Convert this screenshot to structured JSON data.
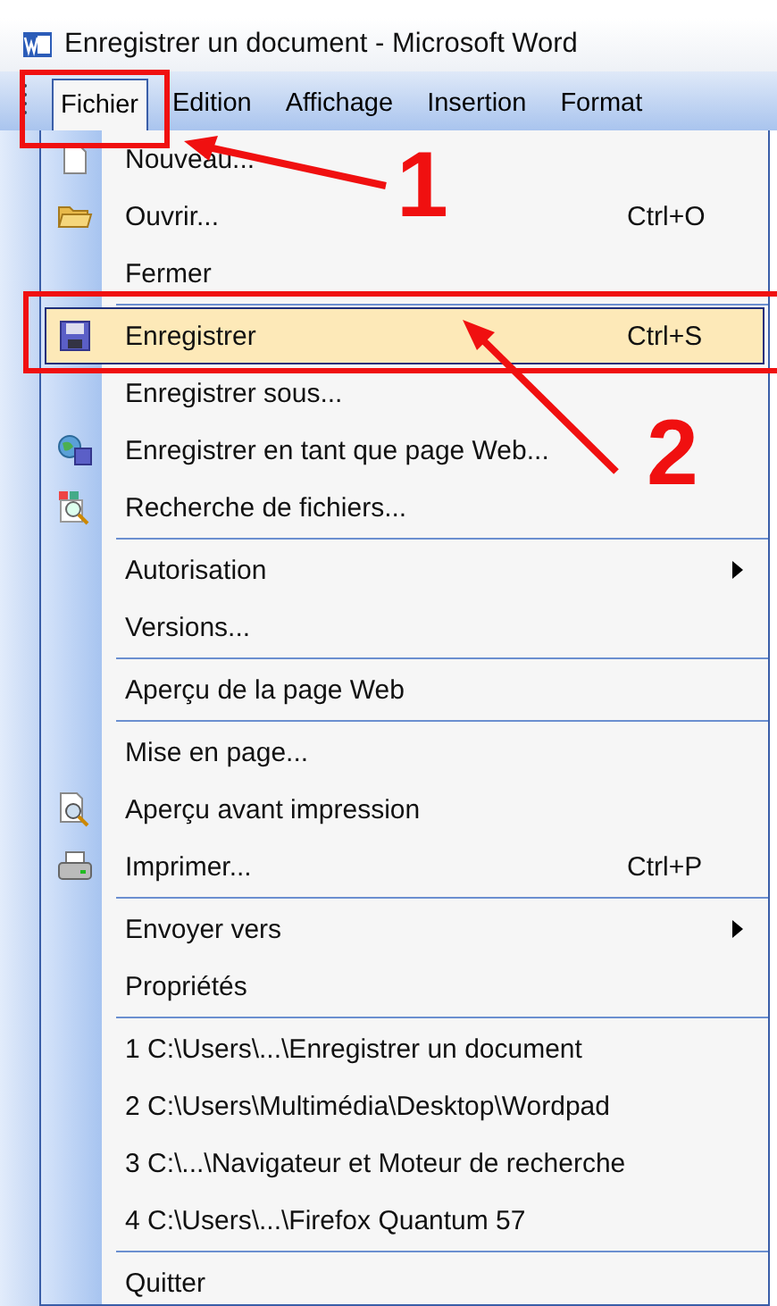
{
  "window": {
    "title": "Enregistrer un document - Microsoft Word"
  },
  "menu_bar": [
    {
      "label": "Fichier",
      "selected": true
    },
    {
      "label": "Edition",
      "selected": false
    },
    {
      "label": "Affichage",
      "selected": false
    },
    {
      "label": "Insertion",
      "selected": false
    },
    {
      "label": "Format",
      "selected": false
    }
  ],
  "menu": [
    {
      "label": "Nouveau...",
      "selected": false
    },
    {
      "label": "Ouvrir...",
      "shortcut": "Ctrl+O",
      "selected": false
    },
    {
      "label": "Fermer",
      "selected": false
    },
    {
      "kind": "separator"
    },
    {
      "label": "Enregistrer",
      "shortcut": "Ctrl+S",
      "selected": true
    },
    {
      "label": "Enregistrer sous...",
      "selected": false
    },
    {
      "label": "Enregistrer en tant que page Web...",
      "selected": false
    },
    {
      "label": "Recherche de fichiers...",
      "selected": false
    },
    {
      "kind": "separator"
    },
    {
      "label": "Autorisation",
      "submenu": true,
      "selected": false
    },
    {
      "label": "Versions...",
      "selected": false
    },
    {
      "kind": "separator"
    },
    {
      "label": "Aperçu de la page Web",
      "selected": false
    },
    {
      "kind": "separator"
    },
    {
      "label": "Mise en page...",
      "selected": false
    },
    {
      "label": "Aperçu avant impression",
      "selected": false
    },
    {
      "label": "Imprimer...",
      "shortcut": "Ctrl+P",
      "selected": false
    },
    {
      "kind": "separator"
    },
    {
      "label": "Envoyer vers",
      "submenu": true,
      "selected": false
    },
    {
      "label": "Propriétés",
      "selected": false
    },
    {
      "kind": "separator"
    },
    {
      "label": "1 C:\\Users\\...\\Enregistrer un document",
      "selected": false
    },
    {
      "label": "2 C:\\Users\\Multimédia\\Desktop\\Wordpad",
      "selected": false
    },
    {
      "label": "3 C:\\...\\Navigateur et Moteur de recherche",
      "selected": false
    },
    {
      "label": "4 C:\\Users\\...\\Firefox Quantum 57",
      "selected": false
    },
    {
      "kind": "separator"
    },
    {
      "label": "Quitter",
      "selected": false
    }
  ],
  "annotations": [
    {
      "label": "1"
    },
    {
      "label": "2"
    }
  ]
}
